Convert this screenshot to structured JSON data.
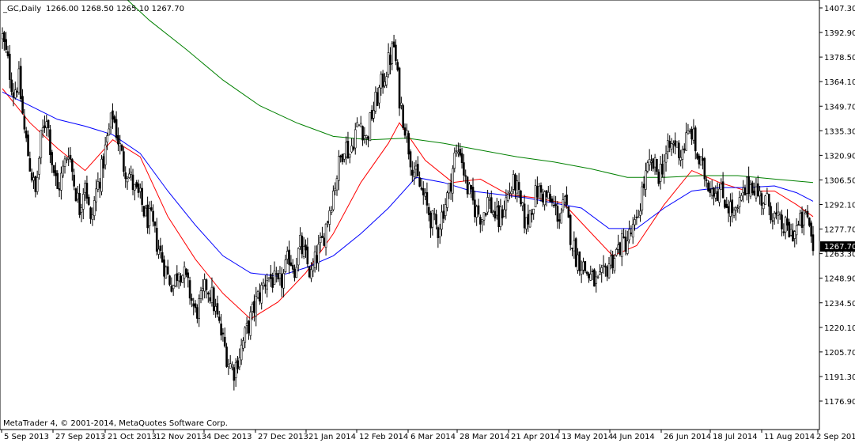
{
  "window": {
    "symbol_title": "_GC,Daily",
    "ohlc": "1266.00 1268.50 1265.10 1267.70",
    "copyright": "MetaTrader 4, © 2001-2014, MetaQuotes Software Corp."
  },
  "colors": {
    "background": "#ffffff",
    "candles": "#000000",
    "ma_fast": "#ff0000",
    "ma_medium": "#0000ff",
    "ma_slow": "#008000",
    "price_tag": "#000000"
  },
  "chart_data": {
    "type": "candlestick",
    "title": "_GC,Daily",
    "ylim": [
      1176.9,
      1407.3
    ],
    "y_ticks": [
      "1407.30",
      "1392.90",
      "1378.50",
      "1364.10",
      "1349.70",
      "1335.30",
      "1320.90",
      "1306.50",
      "1292.10",
      "1277.70",
      "1263.30",
      "1248.90",
      "1234.50",
      "1220.10",
      "1205.70",
      "1191.30",
      "1176.90"
    ],
    "x_ticks": [
      "5 Sep 2013",
      "27 Sep 2013",
      "21 Oct 2013",
      "12 Nov 2013",
      "4 Dec 2013",
      "27 Dec 2013",
      "21 Jan 2014",
      "12 Feb 2014",
      "6 Mar 2014",
      "28 Mar 2014",
      "21 Apr 2014",
      "13 May 2014",
      "4 Jun 2014",
      "26 Jun 2014",
      "18 Jul 2014",
      "11 Aug 2014",
      "2 Sep 2014"
    ],
    "last_price": "1267.70",
    "close_path": [
      [
        0,
        1390
      ],
      [
        3,
        1375
      ],
      [
        6,
        1358
      ],
      [
        9,
        1365
      ],
      [
        12,
        1335
      ],
      [
        15,
        1315
      ],
      [
        18,
        1298
      ],
      [
        21,
        1330
      ],
      [
        24,
        1345
      ],
      [
        27,
        1318
      ],
      [
        30,
        1300
      ],
      [
        33,
        1312
      ],
      [
        36,
        1325
      ],
      [
        39,
        1305
      ],
      [
        42,
        1290
      ],
      [
        45,
        1308
      ],
      [
        48,
        1280
      ],
      [
        51,
        1300
      ],
      [
        54,
        1312
      ],
      [
        57,
        1330
      ],
      [
        60,
        1345
      ],
      [
        63,
        1330
      ],
      [
        66,
        1315
      ],
      [
        69,
        1310
      ],
      [
        72,
        1300
      ],
      [
        75,
        1295
      ],
      [
        78,
        1285
      ],
      [
        81,
        1282
      ],
      [
        84,
        1270
      ],
      [
        87,
        1260
      ],
      [
        90,
        1250
      ],
      [
        93,
        1245
      ],
      [
        96,
        1255
      ],
      [
        99,
        1250
      ],
      [
        102,
        1240
      ],
      [
        105,
        1228
      ],
      [
        108,
        1235
      ],
      [
        111,
        1245
      ],
      [
        114,
        1238
      ],
      [
        117,
        1225
      ],
      [
        120,
        1212
      ],
      [
        123,
        1200
      ],
      [
        126,
        1195
      ],
      [
        129,
        1205
      ],
      [
        132,
        1215
      ],
      [
        135,
        1225
      ],
      [
        138,
        1235
      ],
      [
        141,
        1242
      ],
      [
        144,
        1250
      ],
      [
        147,
        1248
      ],
      [
        150,
        1243
      ],
      [
        153,
        1250
      ],
      [
        156,
        1262
      ],
      [
        159,
        1255
      ],
      [
        162,
        1268
      ],
      [
        165,
        1260
      ],
      [
        168,
        1250
      ],
      [
        171,
        1262
      ],
      [
        174,
        1270
      ],
      [
        177,
        1285
      ],
      [
        180,
        1300
      ],
      [
        183,
        1315
      ],
      [
        186,
        1328
      ],
      [
        189,
        1322
      ],
      [
        192,
        1335
      ],
      [
        195,
        1340
      ],
      [
        198,
        1330
      ],
      [
        201,
        1345
      ],
      [
        204,
        1355
      ],
      [
        207,
        1365
      ],
      [
        210,
        1375
      ],
      [
        213,
        1385
      ],
      [
        216,
        1355
      ],
      [
        219,
        1338
      ],
      [
        222,
        1320
      ],
      [
        225,
        1308
      ],
      [
        228,
        1300
      ],
      [
        231,
        1290
      ],
      [
        234,
        1282
      ],
      [
        237,
        1278
      ],
      [
        240,
        1290
      ],
      [
        243,
        1300
      ],
      [
        246,
        1320
      ],
      [
        249,
        1325
      ],
      [
        252,
        1305
      ],
      [
        255,
        1295
      ],
      [
        258,
        1288
      ],
      [
        261,
        1285
      ],
      [
        264,
        1295
      ],
      [
        267,
        1288
      ],
      [
        270,
        1282
      ],
      [
        273,
        1292
      ],
      [
        276,
        1300
      ],
      [
        279,
        1305
      ],
      [
        282,
        1290
      ],
      [
        285,
        1280
      ],
      [
        288,
        1292
      ],
      [
        291,
        1300
      ],
      [
        294,
        1298
      ],
      [
        297,
        1295
      ],
      [
        300,
        1290
      ],
      [
        303,
        1285
      ],
      [
        306,
        1292
      ],
      [
        309,
        1275
      ],
      [
        312,
        1262
      ],
      [
        315,
        1258
      ],
      [
        318,
        1252
      ],
      [
        321,
        1248
      ],
      [
        324,
        1245
      ],
      [
        327,
        1250
      ],
      [
        330,
        1258
      ],
      [
        333,
        1262
      ],
      [
        336,
        1268
      ],
      [
        339,
        1270
      ],
      [
        342,
        1275
      ],
      [
        345,
        1280
      ],
      [
        348,
        1300
      ],
      [
        351,
        1312
      ],
      [
        354,
        1315
      ],
      [
        357,
        1310
      ],
      [
        360,
        1318
      ],
      [
        363,
        1325
      ],
      [
        366,
        1328
      ],
      [
        369,
        1322
      ],
      [
        372,
        1330
      ],
      [
        375,
        1335
      ],
      [
        378,
        1320
      ],
      [
        381,
        1312
      ],
      [
        384,
        1305
      ],
      [
        387,
        1302
      ],
      [
        390,
        1300
      ],
      [
        393,
        1295
      ],
      [
        396,
        1290
      ],
      [
        399,
        1285
      ],
      [
        402,
        1295
      ],
      [
        405,
        1302
      ],
      [
        408,
        1305
      ],
      [
        411,
        1298
      ],
      [
        414,
        1295
      ],
      [
        417,
        1292
      ],
      [
        420,
        1285
      ],
      [
        423,
        1280
      ],
      [
        426,
        1278
      ],
      [
        429,
        1275
      ],
      [
        432,
        1278
      ],
      [
        435,
        1282
      ],
      [
        438,
        1285
      ],
      [
        441,
        1268
      ]
    ],
    "series": [
      {
        "values": [
          [
            0,
            1360
          ],
          [
            15,
            1340
          ],
          [
            30,
            1325
          ],
          [
            45,
            1312
          ],
          [
            60,
            1330
          ],
          [
            75,
            1320
          ],
          [
            90,
            1285
          ],
          [
            105,
            1260
          ],
          [
            120,
            1240
          ],
          [
            135,
            1225
          ],
          [
            150,
            1235
          ],
          [
            165,
            1252
          ],
          [
            180,
            1275
          ],
          [
            195,
            1305
          ],
          [
            210,
            1328
          ],
          [
            216,
            1340
          ],
          [
            230,
            1318
          ],
          [
            245,
            1305
          ],
          [
            260,
            1307
          ],
          [
            275,
            1298
          ],
          [
            290,
            1296
          ],
          [
            305,
            1293
          ],
          [
            318,
            1278
          ],
          [
            332,
            1262
          ],
          [
            345,
            1268
          ],
          [
            360,
            1292
          ],
          [
            375,
            1312
          ],
          [
            390,
            1305
          ],
          [
            405,
            1300
          ],
          [
            420,
            1300
          ],
          [
            432,
            1292
          ],
          [
            441,
            1285
          ]
        ]
      },
      {
        "values": [
          [
            0,
            1358
          ],
          [
            15,
            1350
          ],
          [
            30,
            1342
          ],
          [
            45,
            1338
          ],
          [
            60,
            1333
          ],
          [
            75,
            1322
          ],
          [
            90,
            1300
          ],
          [
            105,
            1280
          ],
          [
            120,
            1262
          ],
          [
            135,
            1252
          ],
          [
            150,
            1250
          ],
          [
            165,
            1255
          ],
          [
            180,
            1262
          ],
          [
            195,
            1275
          ],
          [
            210,
            1290
          ],
          [
            225,
            1308
          ],
          [
            240,
            1305
          ],
          [
            255,
            1300
          ],
          [
            270,
            1298
          ],
          [
            285,
            1296
          ],
          [
            300,
            1293
          ],
          [
            315,
            1290
          ],
          [
            330,
            1278
          ],
          [
            345,
            1278
          ],
          [
            360,
            1290
          ],
          [
            375,
            1300
          ],
          [
            390,
            1302
          ],
          [
            405,
            1302
          ],
          [
            420,
            1303
          ],
          [
            432,
            1299
          ],
          [
            441,
            1294
          ]
        ]
      },
      {
        "values": [
          [
            60,
            1420
          ],
          [
            80,
            1400
          ],
          [
            100,
            1383
          ],
          [
            120,
            1365
          ],
          [
            140,
            1350
          ],
          [
            160,
            1340
          ],
          [
            180,
            1332
          ],
          [
            200,
            1330
          ],
          [
            220,
            1331
          ],
          [
            240,
            1328
          ],
          [
            260,
            1324
          ],
          [
            280,
            1320
          ],
          [
            300,
            1317
          ],
          [
            320,
            1313
          ],
          [
            340,
            1308
          ],
          [
            360,
            1308
          ],
          [
            380,
            1309
          ],
          [
            400,
            1309
          ],
          [
            420,
            1307
          ],
          [
            441,
            1305
          ]
        ]
      }
    ]
  }
}
